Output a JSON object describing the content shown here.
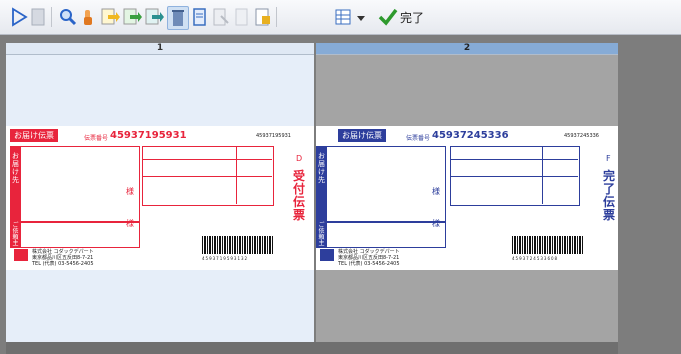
{
  "toolbar": {
    "buttons": [
      {
        "name": "play-icon",
        "color": "#2a64c8"
      },
      {
        "name": "blank-page-icon",
        "color": "#b0b6c2"
      },
      {
        "name": "magnifier-icon",
        "color": "#2a64c8"
      },
      {
        "name": "hand-icon",
        "color": "#e07820"
      },
      {
        "name": "page-arrow-yellow-icon",
        "color": "#f0b820"
      },
      {
        "name": "page-arrow-green-icon",
        "color": "#3aa040"
      },
      {
        "name": "page-arrow-teal-icon",
        "color": "#2a9090"
      },
      {
        "name": "trash-icon",
        "color": "#6e8bb8"
      },
      {
        "name": "page-icon",
        "color": "#3a6ec0"
      },
      {
        "name": "page-crop-icon",
        "color": "#b8bcc4"
      },
      {
        "name": "page-gray-icon",
        "color": "#c8ccd4"
      },
      {
        "name": "page-highlight-icon",
        "color": "#e8b020"
      },
      {
        "name": "grid-icon",
        "color": "#3a6ec0"
      }
    ],
    "done_label": "完了"
  },
  "pages": [
    {
      "number": "1",
      "header_title": "お届け伝票",
      "tracking_label": "伝票番号",
      "tracking_number": "45937195931",
      "tracking_small": "459371959­31",
      "side_top": "お届け先",
      "side_bottom": "ご依頼主",
      "sama_top": "様",
      "sama_bottom": "様",
      "company_line1": "株式会社 コダックデパート",
      "company_line2": "東京都品川区五反田8-7-21",
      "company_line3": "TEL (代表) 03-5456-2405",
      "barcode_digits": "4593719593132",
      "slip_letter": "D",
      "slip_vertical": "受付伝票",
      "accent": "#e8243c"
    },
    {
      "number": "2",
      "header_title": "お届け伝票",
      "tracking_label": "伝票番号",
      "tracking_number": "45937245336",
      "tracking_small": "45937245336",
      "side_top": "お届け先",
      "side_bottom": "ご依頼主",
      "sama_top": "様",
      "sama_bottom": "様",
      "company_line1": "株式会社 コダックデパート",
      "company_line2": "東京都品川区五反田8-7-21",
      "company_line3": "TEL (代表) 03-5456-2405",
      "barcode_digits": "4593724533608",
      "slip_letter": "F",
      "slip_vertical": "完了伝票",
      "accent": "#2d3e9c"
    }
  ]
}
